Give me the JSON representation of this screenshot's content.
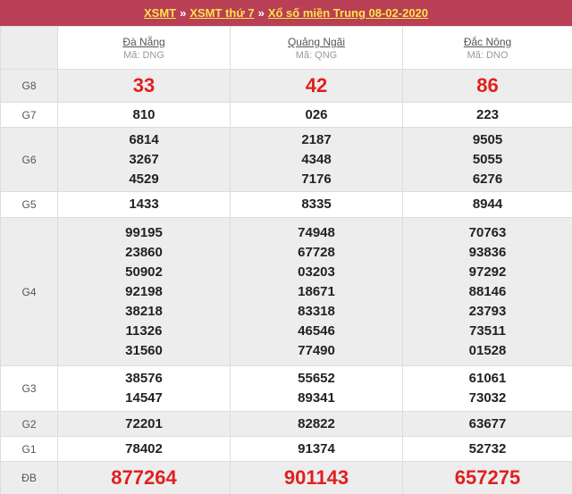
{
  "header": {
    "link1": "XSMT",
    "sep1": "»",
    "link2": "XSMT thứ 7",
    "sep2": "»",
    "link3": "Xổ số miền Trung 08-02-2020"
  },
  "provinces": [
    {
      "name": "Đà Nẵng",
      "code": "Mã: DNG"
    },
    {
      "name": "Quảng Ngãi",
      "code": "Mã: QNG"
    },
    {
      "name": "Đắc Nông",
      "code": "Mã: DNO"
    }
  ],
  "prizes": {
    "g8": {
      "label": "G8",
      "values": [
        "33",
        "42",
        "86"
      ]
    },
    "g7": {
      "label": "G7",
      "values": [
        "810",
        "026",
        "223"
      ]
    },
    "g6": {
      "label": "G6",
      "values": [
        [
          "6814",
          "3267",
          "4529"
        ],
        [
          "2187",
          "4348",
          "7176"
        ],
        [
          "9505",
          "5055",
          "6276"
        ]
      ]
    },
    "g5": {
      "label": "G5",
      "values": [
        "1433",
        "8335",
        "8944"
      ]
    },
    "g4": {
      "label": "G4",
      "values": [
        [
          "99195",
          "23860",
          "50902",
          "92198",
          "38218",
          "11326",
          "31560"
        ],
        [
          "74948",
          "67728",
          "03203",
          "18671",
          "83318",
          "46546",
          "77490"
        ],
        [
          "70763",
          "93836",
          "97292",
          "88146",
          "23793",
          "73511",
          "01528"
        ]
      ]
    },
    "g3": {
      "label": "G3",
      "values": [
        [
          "38576",
          "14547"
        ],
        [
          "55652",
          "89341"
        ],
        [
          "61061",
          "73032"
        ]
      ]
    },
    "g2": {
      "label": "G2",
      "values": [
        "72201",
        "82822",
        "63677"
      ]
    },
    "g1": {
      "label": "G1",
      "values": [
        "78402",
        "91374",
        "52732"
      ]
    },
    "db": {
      "label": "ĐB",
      "values": [
        "877264",
        "901143",
        "657275"
      ]
    }
  },
  "colors": {
    "header_bg": "#b83f55",
    "header_link": "#ffe24a",
    "highlight": "#e02020",
    "row_grey": "#ededed"
  }
}
